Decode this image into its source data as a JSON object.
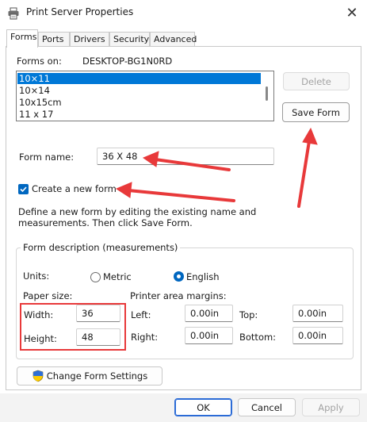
{
  "window": {
    "title": "Print Server Properties",
    "close_glyph": "✕"
  },
  "tabs": [
    {
      "label": "Forms",
      "active": true
    },
    {
      "label": "Ports"
    },
    {
      "label": "Drivers"
    },
    {
      "label": "Security"
    },
    {
      "label": "Advanced"
    }
  ],
  "forms_on": {
    "label": "Forms on:",
    "server": "DESKTOP-BG1N0RD"
  },
  "forms_list": [
    "10×11",
    "10×14",
    "10x15cm",
    "11 x 17"
  ],
  "selected_form_index": 0,
  "buttons": {
    "delete": "Delete",
    "save_form": "Save Form",
    "change_form_settings": "Change Form Settings",
    "ok": "OK",
    "cancel": "Cancel",
    "apply": "Apply"
  },
  "form_name": {
    "label": "Form name:",
    "value": "36 X 48"
  },
  "create_new_form": {
    "label": "Create a new form",
    "checked": true
  },
  "instructions": {
    "line1": "Define a new form by editing the existing name and",
    "line2": "measurements. Then click Save Form."
  },
  "form_description": {
    "title": "Form description (measurements)",
    "units_label": "Units:",
    "metric_label": "Metric",
    "english_label": "English",
    "selected_unit": "English",
    "paper_size_label": "Paper size:",
    "width_label": "Width:",
    "width_value": "36",
    "height_label": "Height:",
    "height_value": "48",
    "margins_label": "Printer area margins:",
    "left_label": "Left:",
    "left_value": "0.00in",
    "right_label": "Right:",
    "right_value": "0.00in",
    "top_label": "Top:",
    "top_value": "0.00in",
    "bottom_label": "Bottom:",
    "bottom_value": "0.00in"
  },
  "colors": {
    "accent": "#0067c0",
    "selection": "#0078d7",
    "annotation_red": "#e8393a"
  },
  "icons": [
    "printer-icon",
    "close-icon",
    "checkmark-icon",
    "uac-shield-icon"
  ]
}
